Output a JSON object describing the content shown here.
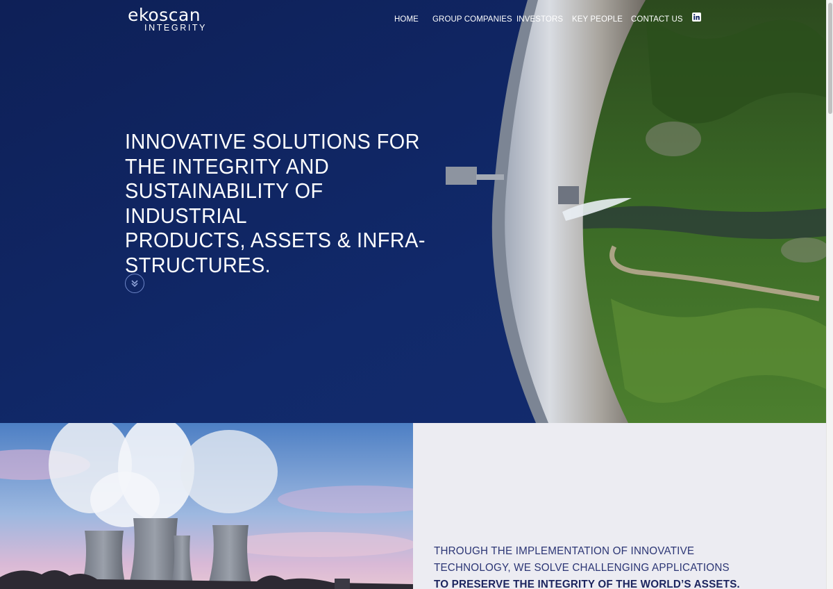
{
  "brand": {
    "logo_main_left": "e",
    "logo_main_k": "k",
    "logo_main_right": "oscan",
    "logo_sub": "INTEGRITY"
  },
  "nav": {
    "home": "HOME",
    "group_companies": "GROUP COMPANIES",
    "investors": "INVESTORS",
    "key_people": "KEY PEOPLE",
    "contact_us": "CONTACT US",
    "linkedin_icon": "linkedin-icon"
  },
  "hero": {
    "line1": "INNOVATIVE SOLUTIONS FOR",
    "line2": "THE INTEGRITY AND",
    "line3": "SUSTAINABILITY OF INDUSTRIAL",
    "line4": "PRODUCTS, ASSETS & INFRA-",
    "line5": "STRUCTURES.",
    "scroll_icon": "chevron-double-down-icon"
  },
  "mission": {
    "normal": "THROUGH THE IMPLEMENTATION OF INNOVATIVE TECHNOLOGY, WE SOLVE CHALLENGING APPLICATIONS ",
    "bold": "TO PRESERVE THE INTEGRITY OF THE WORLD’S ASSETS."
  },
  "colors": {
    "hero_navy": "#0f2461",
    "panel_bg": "#ececf2",
    "mission_text": "#2c3675"
  }
}
